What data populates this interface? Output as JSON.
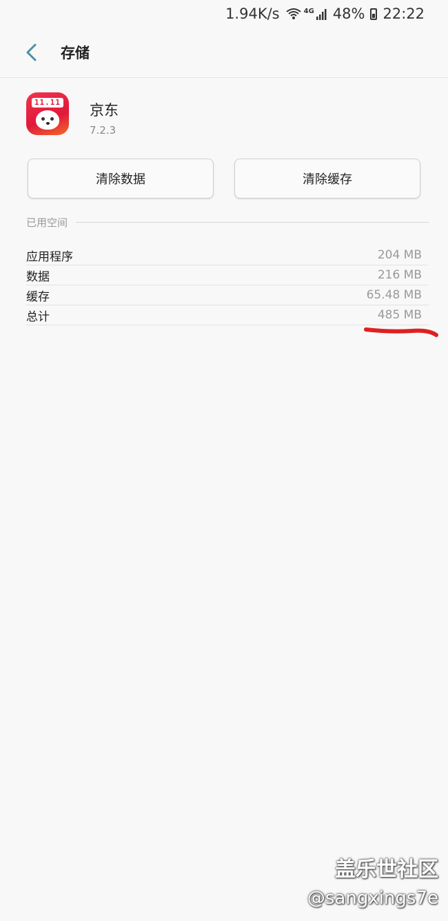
{
  "status_bar": {
    "speed": "1.94K/s",
    "network": "4G",
    "battery": "48%",
    "time": "22:22"
  },
  "header": {
    "title": "存储"
  },
  "app": {
    "name": "京东",
    "version": "7.2.3",
    "icon_text": "11.11"
  },
  "buttons": {
    "clear_data": "清除数据",
    "clear_cache": "清除缓存"
  },
  "section": {
    "title": "已用空间"
  },
  "storage": {
    "rows": [
      {
        "label": "应用程序",
        "value": "204 MB"
      },
      {
        "label": "数据",
        "value": "216 MB"
      },
      {
        "label": "缓存",
        "value": "65.48 MB"
      },
      {
        "label": "总计",
        "value": "485 MB"
      }
    ]
  },
  "watermark": {
    "line1": "盖乐世社区",
    "line2": "@sangxings7e"
  },
  "colors": {
    "accent": "#4a90a4",
    "highlight": "#e02020"
  }
}
